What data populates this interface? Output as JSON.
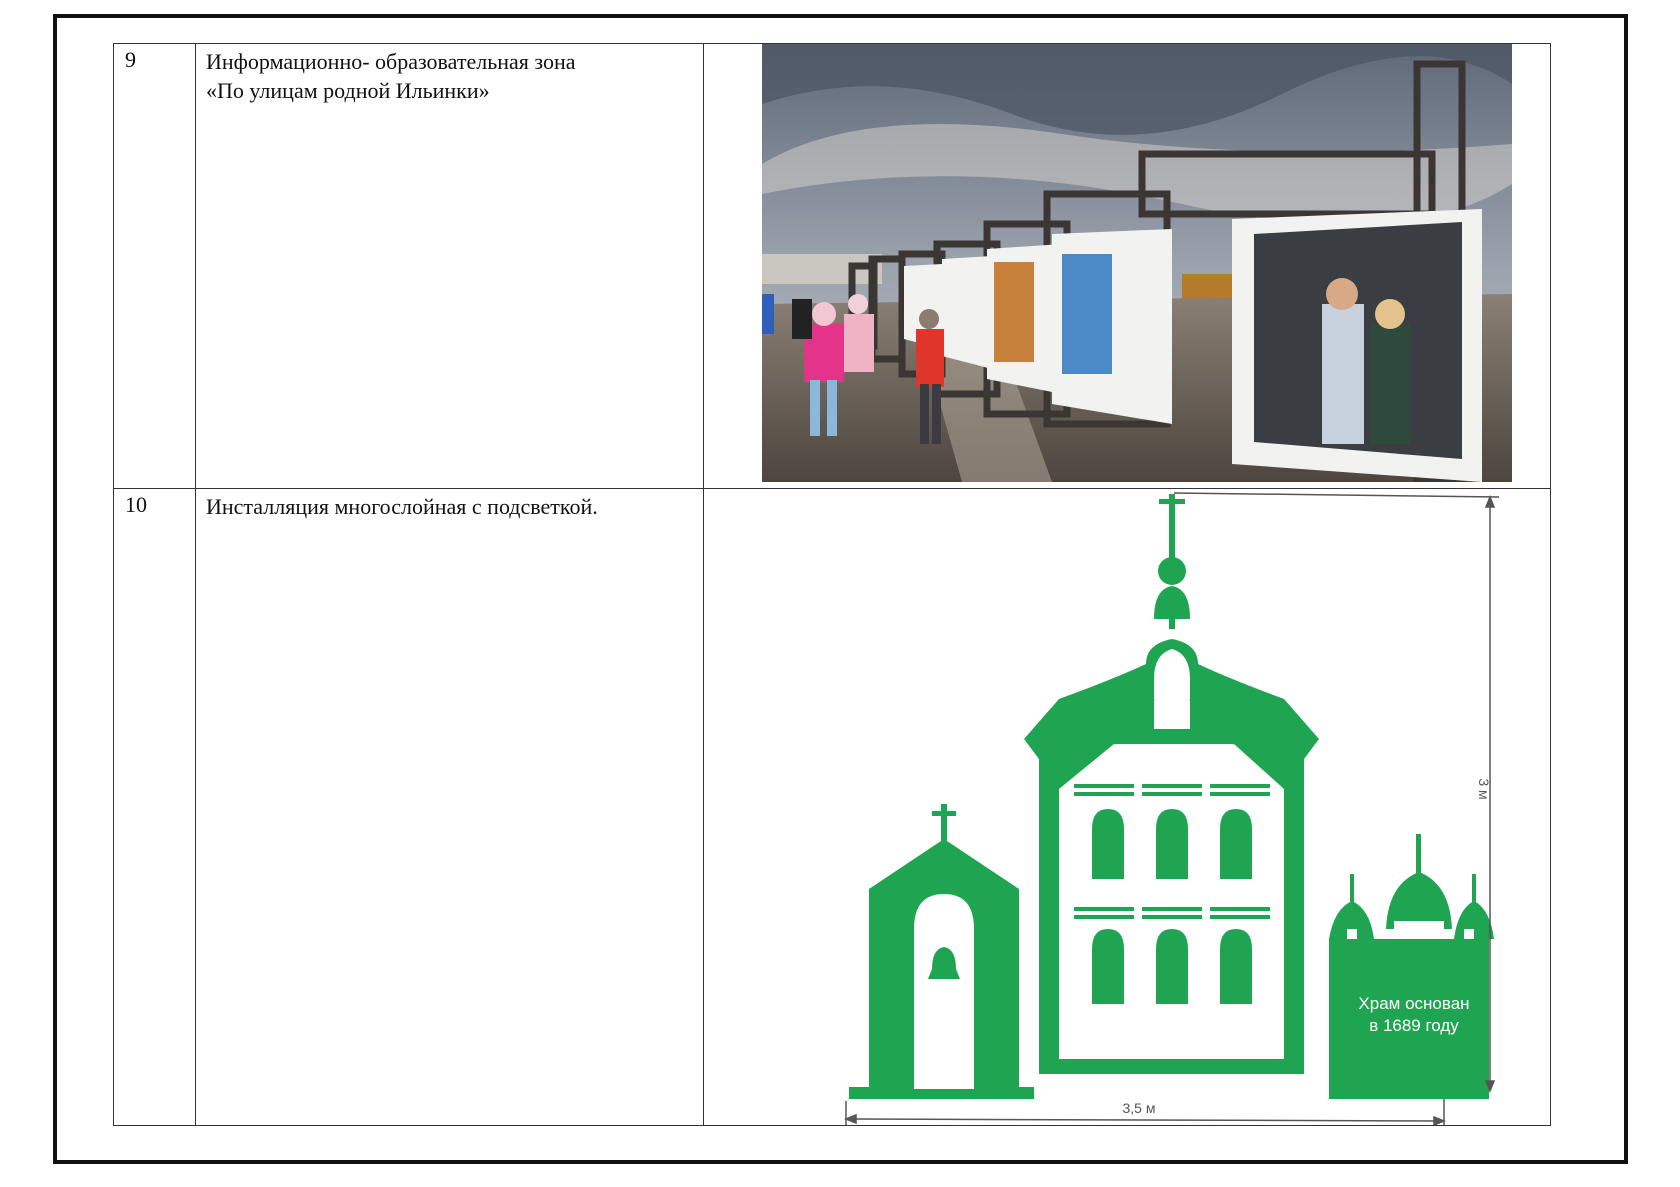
{
  "rows": [
    {
      "number": "9",
      "title_line1": "Информационно- образовательная зона",
      "title_line2": "«По улицам родной Ильинки»"
    },
    {
      "number": "10",
      "title_line1": "Инсталляция многослойная с подсветкой."
    }
  ],
  "drawing": {
    "plaque_line1": "Храм основан",
    "plaque_line2": "в 1689 году",
    "height_label": "3 м",
    "width_label": "3,5 м",
    "green": "#1fa552"
  },
  "colors": {
    "border": "#111111",
    "sky": "#7d8694",
    "frame_metal": "#3b3633"
  }
}
